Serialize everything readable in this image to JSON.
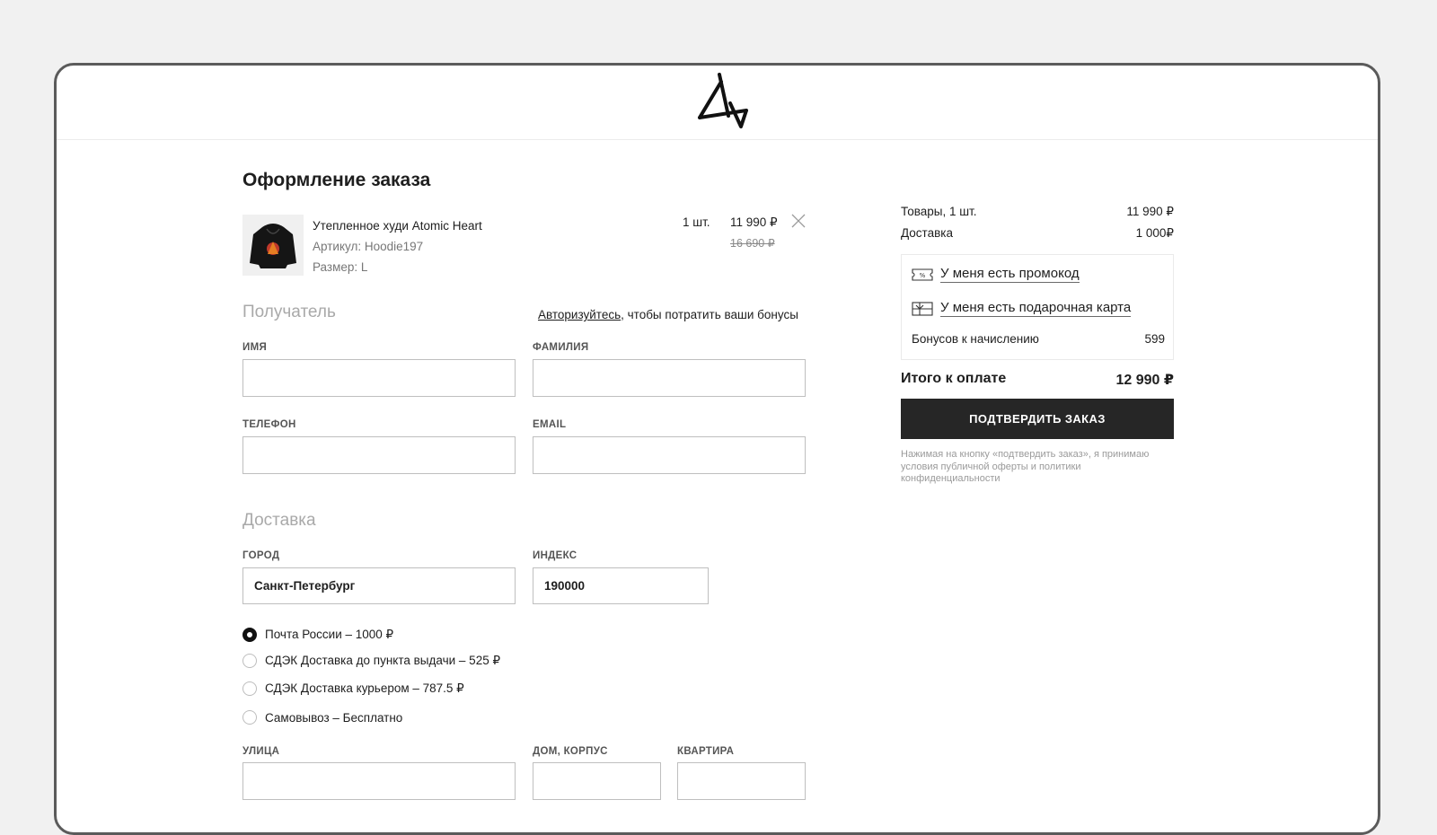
{
  "logo": {
    "icon": "brand-logo-icon"
  },
  "page_title": "Оформление заказа",
  "product": {
    "name": "Утепленное худи Atomic Heart",
    "sku": "Артикул: Hoodie197",
    "size": "Размер: L",
    "qty": "1 шт.",
    "price": "11 990 ₽",
    "old_price": "16 690 ₽"
  },
  "recipient": {
    "title": "Получатель",
    "auth_link": "Авторизуйтесь",
    "auth_suffix": ", чтобы потратить ваши бонусы",
    "first_name_label": "ИМЯ",
    "last_name_label": "ФАМИЛИЯ",
    "phone_label": "ТЕЛЕФОН",
    "email_label": "EMAIL",
    "first_name_value": "",
    "last_name_value": "",
    "phone_value": "",
    "email_value": ""
  },
  "delivery": {
    "title": "Доставка",
    "city_label": "ГОРОД",
    "city_value": "Санкт-Петербург",
    "index_label": "ИНДЕКС",
    "index_value": "190000",
    "options": [
      {
        "label": "Почта России – 1000 ₽",
        "checked": true
      },
      {
        "label": "СДЭК Доставка до пункта выдачи – 525 ₽",
        "checked": false
      },
      {
        "label": "СДЭК Доставка курьером – 787.5 ₽",
        "checked": false
      },
      {
        "label": "Самовывоз – Бесплатно",
        "checked": false
      }
    ],
    "street_label": "УЛИЦА",
    "house_label": "ДОМ, КОРПУС",
    "apartment_label": "КВАРТИРА"
  },
  "summary": {
    "goods_label": "Товары, 1 шт.",
    "goods_value": "11 990 ₽",
    "delivery_label": "Доставка",
    "delivery_value": "1 000₽",
    "promo_label": "У меня есть промокод",
    "gift_label": "У меня есть подарочная карта",
    "bonus_label": "Бонусов к начислению",
    "bonus_value": "599",
    "total_label": "Итого к оплате",
    "total_value": "12 990 ₽",
    "confirm_label": "ПОДТВЕРДИТЬ ЗАКАЗ",
    "disclaimer": "Нажимая на кнопку «подтвердить заказ», я принимаю условия публичной оферты и политики конфиденциальности"
  },
  "colors": {
    "accent": "#262626",
    "muted": "#a9a9a9",
    "background": "#f1f1f1"
  }
}
